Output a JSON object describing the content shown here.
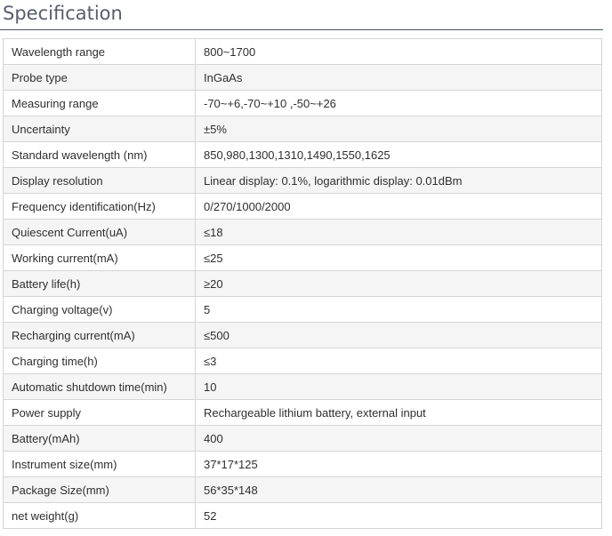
{
  "page": {
    "title": "Specification"
  },
  "spec_rows": [
    {
      "label": "Wavelength range",
      "value": "800~1700"
    },
    {
      "label": "Probe type",
      "value": "InGaAs"
    },
    {
      "label": "Measuring range",
      "value": "-70~+6,-70~+10 ,-50~+26"
    },
    {
      "label": "Uncertainty",
      "value": "±5%"
    },
    {
      "label": "Standard wavelength (nm)",
      "value": "850,980,1300,1310,1490,1550,1625"
    },
    {
      "label": "Display resolution",
      "value": "Linear display: 0.1%, logarithmic display: 0.01dBm"
    },
    {
      "label": "Frequency identification(Hz)",
      "value": "0/270/1000/2000"
    },
    {
      "label": "Quiescent Current(uA)",
      "value": "≤18"
    },
    {
      "label": "Working current(mA)",
      "value": "≤25"
    },
    {
      "label": "Battery life(h)",
      "value": "≥20"
    },
    {
      "label": "Charging voltage(v)",
      "value": "5"
    },
    {
      "label": "Recharging current(mA)",
      "value": "≤500"
    },
    {
      "label": "Charging time(h)",
      "value": "≤3"
    },
    {
      "label": "Automatic shutdown time(min)",
      "value": "10"
    },
    {
      "label": "Power supply",
      "value": "Rechargeable lithium battery, external input"
    },
    {
      "label": "Battery(mAh)",
      "value": "400"
    },
    {
      "label": "Instrument size(mm)",
      "value": "37*17*125"
    },
    {
      "label": "Package Size(mm)",
      "value": "56*35*148"
    },
    {
      "label": "net weight(g)",
      "value": "52"
    }
  ]
}
